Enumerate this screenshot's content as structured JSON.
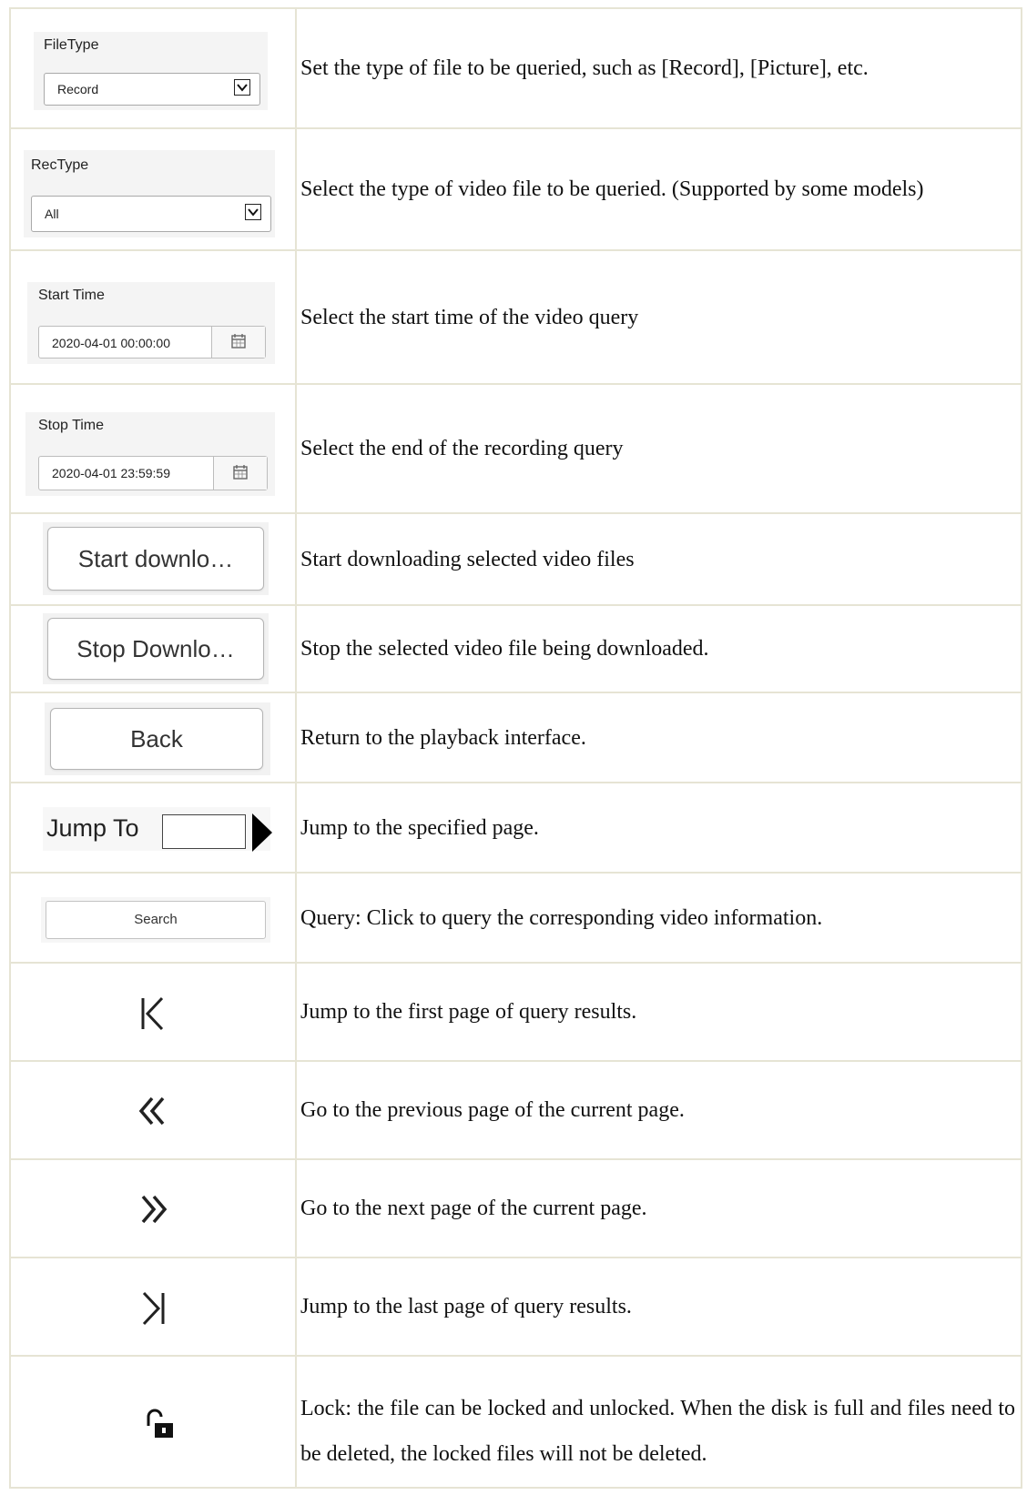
{
  "rows": [
    {
      "widget": {
        "label": "FileType",
        "value": "Record",
        "icon": "chevron-down-icon"
      },
      "description": "Set the type of file to be queried, such as [Record], [Picture], etc."
    },
    {
      "widget": {
        "label": "RecType",
        "value": "All",
        "icon": "chevron-down-icon"
      },
      "description": "Select the type of video file to be queried. (Supported by some models)"
    },
    {
      "widget": {
        "label": "Start Time",
        "value": "2020-04-01 00:00:00",
        "icon": "calendar-icon"
      },
      "description": "Select the start time of the video query"
    },
    {
      "widget": {
        "label": "Stop Time",
        "value": "2020-04-01 23:59:59",
        "icon": "calendar-icon"
      },
      "description": "Select the end of the recording query"
    },
    {
      "widget": {
        "label": "Start downlo…"
      },
      "description": "Start downloading selected video files"
    },
    {
      "widget": {
        "label": "Stop Downlo…"
      },
      "description": "Stop the selected video file being downloaded."
    },
    {
      "widget": {
        "label": "Back"
      },
      "description": "Return to the playback interface."
    },
    {
      "widget": {
        "label": "Jump To",
        "input_value": "",
        "icon": "play-triangle-icon"
      },
      "description": "Jump to the specified page."
    },
    {
      "widget": {
        "label": "Search"
      },
      "description": "Query: Click to query the corresponding video information."
    },
    {
      "widget": {
        "icon": "first-page-icon"
      },
      "description": "Jump to the first page of query results."
    },
    {
      "widget": {
        "icon": "previous-page-icon"
      },
      "description": "Go to the previous page of the current page."
    },
    {
      "widget": {
        "icon": "next-page-icon"
      },
      "description": "Go to the next page of the current page."
    },
    {
      "widget": {
        "icon": "last-page-icon"
      },
      "description": "Jump to the last page of query results."
    },
    {
      "widget": {
        "icon": "unlock-icon"
      },
      "description": "Lock: the file can be locked and unlocked. When the disk is full and files need to be deleted, the locked files will not be deleted."
    }
  ]
}
